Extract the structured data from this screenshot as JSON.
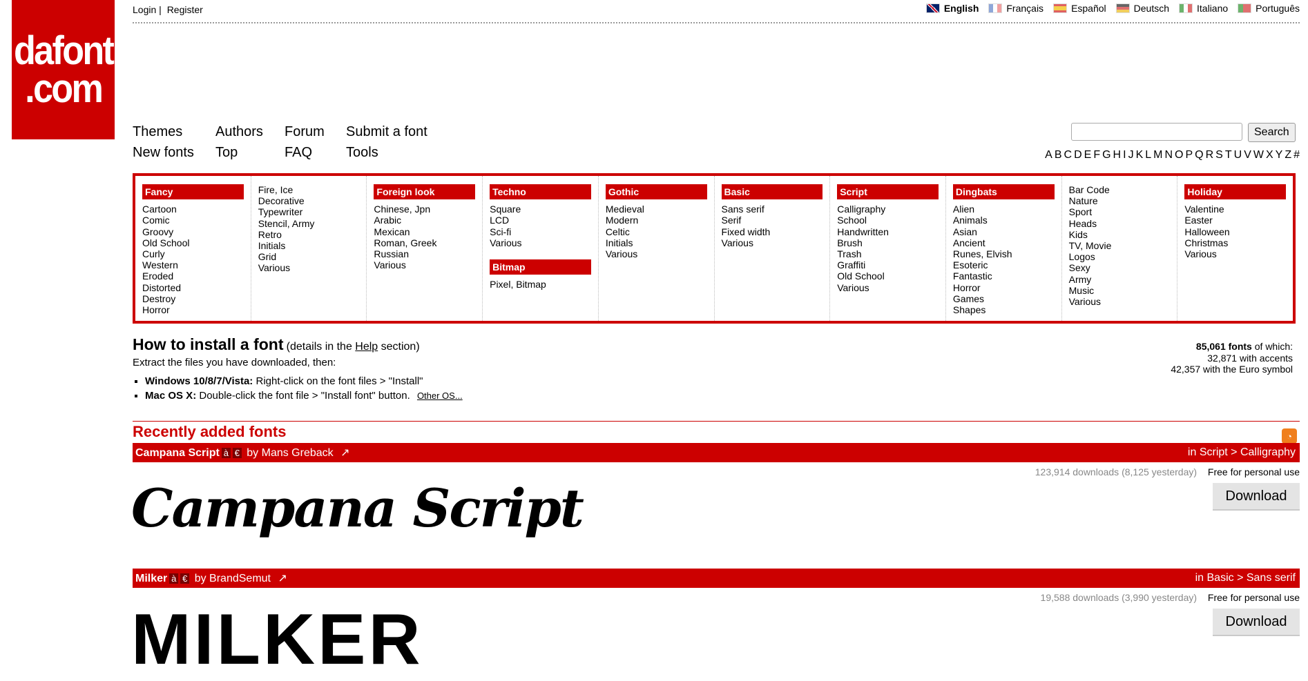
{
  "logo": {
    "line1": "dafont",
    "line2": ".com"
  },
  "auth": {
    "login": "Login",
    "sep": "|",
    "register": "Register"
  },
  "languages": [
    {
      "label": "English",
      "active": true
    },
    {
      "label": "Français",
      "active": false
    },
    {
      "label": "Español",
      "active": false
    },
    {
      "label": "Deutsch",
      "active": false
    },
    {
      "label": "Italiano",
      "active": false
    },
    {
      "label": "Português",
      "active": false
    }
  ],
  "nav": {
    "themes": "Themes",
    "authors": "Authors",
    "forum": "Forum",
    "submit": "Submit a font",
    "new_fonts": "New fonts",
    "top": "Top",
    "faq": "FAQ",
    "tools": "Tools"
  },
  "search": {
    "button": "Search",
    "value": ""
  },
  "alphabet": [
    "A",
    "B",
    "C",
    "D",
    "E",
    "F",
    "G",
    "H",
    "I",
    "J",
    "K",
    "L",
    "M",
    "N",
    "O",
    "P",
    "Q",
    "R",
    "S",
    "T",
    "U",
    "V",
    "W",
    "X",
    "Y",
    "Z",
    "#"
  ],
  "categories": {
    "fancy": {
      "title": "Fancy",
      "items": [
        "Cartoon",
        "Comic",
        "Groovy",
        "Old School",
        "Curly",
        "Western",
        "Eroded",
        "Distorted",
        "Destroy",
        "Horror"
      ]
    },
    "fancy2": {
      "items": [
        "Fire, Ice",
        "Decorative",
        "Typewriter",
        "Stencil, Army",
        "Retro",
        "Initials",
        "Grid",
        "Various"
      ]
    },
    "foreign": {
      "title": "Foreign look",
      "items": [
        "Chinese, Jpn",
        "Arabic",
        "Mexican",
        "Roman, Greek",
        "Russian",
        "Various"
      ]
    },
    "techno": {
      "title": "Techno",
      "items": [
        "Square",
        "LCD",
        "Sci-fi",
        "Various"
      ]
    },
    "bitmap": {
      "title": "Bitmap",
      "items": [
        "Pixel, Bitmap"
      ]
    },
    "gothic": {
      "title": "Gothic",
      "items": [
        "Medieval",
        "Modern",
        "Celtic",
        "Initials",
        "Various"
      ]
    },
    "basic": {
      "title": "Basic",
      "items": [
        "Sans serif",
        "Serif",
        "Fixed width",
        "Various"
      ]
    },
    "script": {
      "title": "Script",
      "items": [
        "Calligraphy",
        "School",
        "Handwritten",
        "Brush",
        "Trash",
        "Graffiti",
        "Old School",
        "Various"
      ]
    },
    "dingbats": {
      "title": "Dingbats",
      "items": [
        "Alien",
        "Animals",
        "Asian",
        "Ancient",
        "Runes, Elvish",
        "Esoteric",
        "Fantastic",
        "Horror",
        "Games",
        "Shapes"
      ]
    },
    "dingbats2": {
      "items": [
        "Bar Code",
        "Nature",
        "Sport",
        "Heads",
        "Kids",
        "TV, Movie",
        "Logos",
        "Sexy",
        "Army",
        "Music",
        "Various"
      ]
    },
    "holiday": {
      "title": "Holiday",
      "items": [
        "Valentine",
        "Easter",
        "Halloween",
        "Christmas",
        "Various"
      ]
    }
  },
  "install": {
    "title": "How to install a font",
    "details_pre": "(details in the ",
    "details_link": "Help",
    "details_post": " section)",
    "intro": "Extract the files you have downloaded, then:",
    "win_label": "Windows 10/8/7/Vista:",
    "win_text": "Right-click on the font files > \"Install\"",
    "mac_label": "Mac OS X:",
    "mac_text": "Double-click the font file > \"Install font\" button.",
    "other": "Other OS..."
  },
  "stats": {
    "total": "85,061 fonts",
    "total_suffix": "of which:",
    "accents": "32,871 with accents",
    "euro": "42,357 with the Euro symbol"
  },
  "recent": {
    "title": "Recently added fonts"
  },
  "fonts": [
    {
      "name": "Campana Script",
      "badge_a": "à",
      "badge_e": "€",
      "by": "by Mans Greback",
      "category": "in Script > Calligraphy",
      "downloads": "123,914 downloads (8,125 yesterday)",
      "license": "Free for personal use",
      "download_label": "Download",
      "preview": "Campana Script"
    },
    {
      "name": "Milker",
      "badge_a": "à",
      "badge_e": "€",
      "by": "by BrandSemut",
      "category": "in Basic > Sans serif",
      "downloads": "19,588 downloads (3,990 yesterday)",
      "license": "Free for personal use",
      "download_label": "Download",
      "preview": "MILKER"
    }
  ],
  "colors": {
    "brand": "#cc0000"
  }
}
